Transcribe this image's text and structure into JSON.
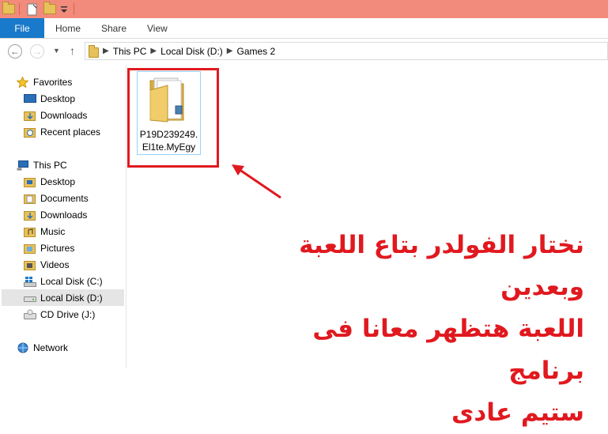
{
  "ribbon": {
    "file": "File",
    "home": "Home",
    "share": "Share",
    "view": "View"
  },
  "address": {
    "crumbs": [
      "This PC",
      "Local Disk (D:)",
      "Games 2"
    ]
  },
  "nav": {
    "favorites": "Favorites",
    "fav_items": [
      "Desktop",
      "Downloads",
      "Recent places"
    ],
    "this_pc": "This PC",
    "pc_items": [
      "Desktop",
      "Documents",
      "Downloads",
      "Music",
      "Pictures",
      "Videos",
      "Local Disk (C:)",
      "Local Disk (D:)",
      "CD Drive (J:)"
    ],
    "network": "Network"
  },
  "content": {
    "folder_name_line1": "P19D239249.",
    "folder_name_line2": "El1te.MyEgy"
  },
  "annotation": {
    "line1": "نختار الفولدر بتاع اللعبة وبعدين",
    "line2": "اللعبة هتظهر معانا فى برنامج",
    "line3": "ستيم عادى",
    "color": "#e0191f"
  }
}
